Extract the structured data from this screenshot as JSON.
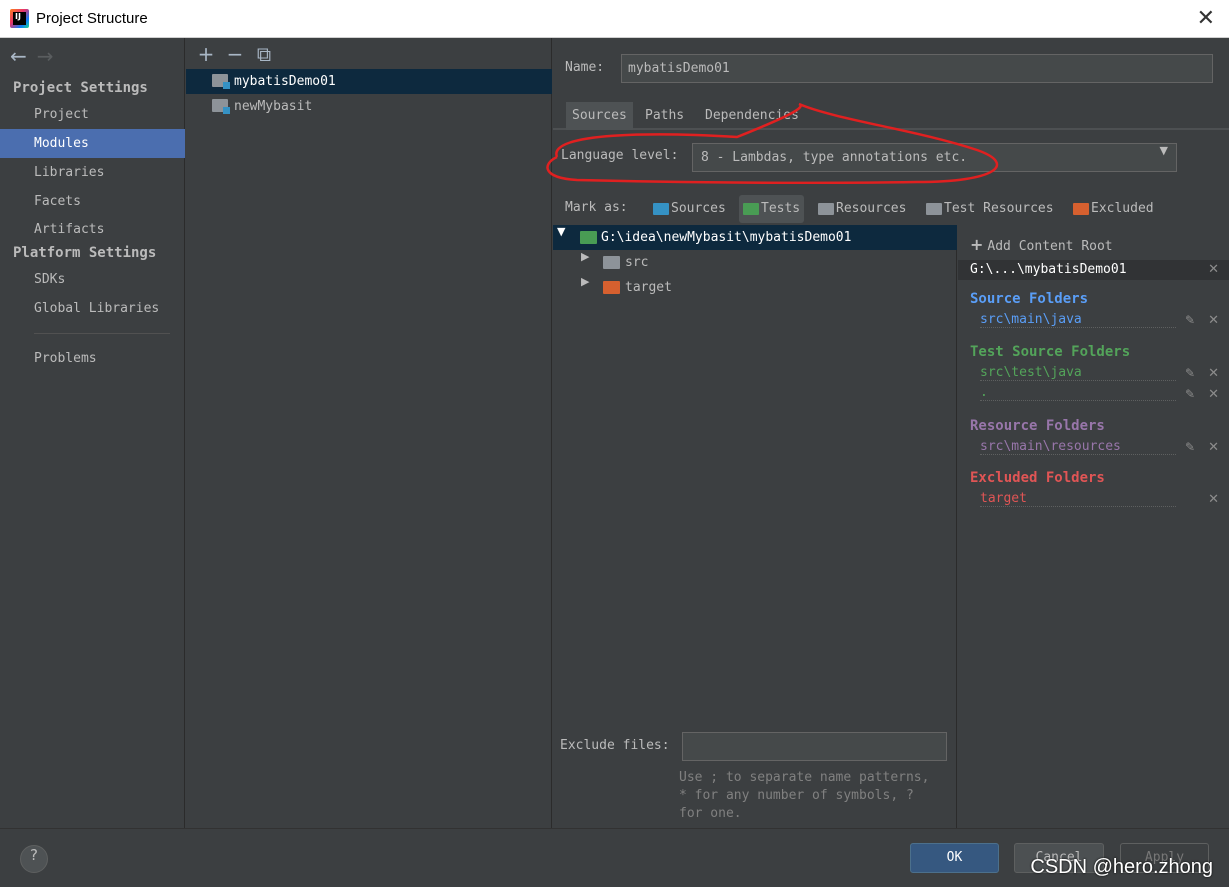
{
  "window": {
    "title": "Project Structure"
  },
  "nav": {
    "project_settings": "Project Settings",
    "platform_settings": "Platform Settings",
    "items": [
      {
        "label": "Project"
      },
      {
        "label": "Modules"
      },
      {
        "label": "Libraries"
      },
      {
        "label": "Facets"
      },
      {
        "label": "Artifacts"
      },
      {
        "label": "SDKs"
      },
      {
        "label": "Global Libraries"
      },
      {
        "label": "Problems"
      }
    ],
    "selected": "Modules"
  },
  "modules": {
    "toolbar": {
      "add": "+",
      "remove": "−",
      "copy": "⧉"
    },
    "list": [
      {
        "label": "mybatisDemo01",
        "selected": true
      },
      {
        "label": "newMybasit",
        "selected": false
      }
    ]
  },
  "module": {
    "name_label": "Name:",
    "name_value": "mybatisDemo01",
    "tabs": [
      {
        "label": "Sources",
        "active": true
      },
      {
        "label": "Paths"
      },
      {
        "label": "Dependencies"
      }
    ],
    "language_level_label": "Language level:",
    "language_level_value": "8 - Lambdas, type annotations etc.",
    "mark_as_label": "Mark as:",
    "mark_as": [
      {
        "label": "Sources",
        "color": "#3592c4"
      },
      {
        "label": "Tests",
        "color": "#499c54",
        "active": true
      },
      {
        "label": "Resources",
        "color": "#8d9399"
      },
      {
        "label": "Test Resources",
        "color": "#8d9399"
      },
      {
        "label": "Excluded",
        "color": "#d6602f"
      }
    ],
    "tree": [
      {
        "label": "G:\\idea\\newMybasit\\mybatisDemo01",
        "expanded": true,
        "selected": true,
        "color": "#499c54"
      },
      {
        "label": "src",
        "expanded": false,
        "color": "#8d9399"
      },
      {
        "label": "target",
        "expanded": false,
        "color": "#d6602f"
      }
    ],
    "exclude_files_label": "Exclude files:",
    "exclude_files_value": "",
    "exclude_hint": "Use ; to separate name patterns,\n* for any number of symbols, ?\nfor one.",
    "content_root": {
      "add_label": "Add Content Root",
      "path": "G:\\...\\mybatisDemo01",
      "source_folders_label": "Source Folders",
      "source_folders": [
        "src\\main\\java"
      ],
      "test_source_folders_label": "Test Source Folders",
      "test_source_folders": [
        "src\\test\\java",
        "."
      ],
      "resource_folders_label": "Resource Folders",
      "resource_folders": [
        "src\\main\\resources"
      ],
      "excluded_folders_label": "Excluded Folders",
      "excluded_folders": [
        "target"
      ],
      "colors": {
        "source": "#5a9ef7",
        "test": "#53a45a",
        "resource": "#9876aa",
        "excluded": "#e05555"
      }
    }
  },
  "footer": {
    "help": "?",
    "ok": "OK",
    "cancel": "Cancel",
    "apply": "Apply",
    "watermark": "CSDN @hero.zhong"
  }
}
